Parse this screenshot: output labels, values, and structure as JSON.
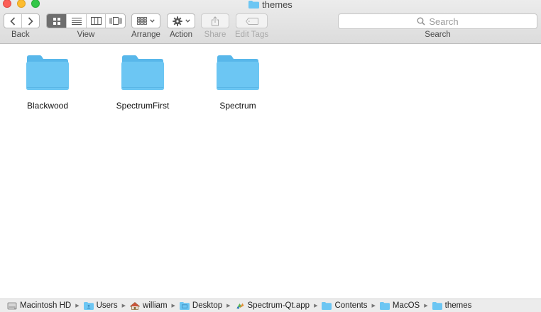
{
  "window": {
    "title": "themes"
  },
  "toolbar": {
    "back_label": "Back",
    "view_label": "View",
    "arrange_label": "Arrange",
    "action_label": "Action",
    "share_label": "Share",
    "edit_tags_label": "Edit Tags",
    "search_label": "Search",
    "search_placeholder": "Search",
    "selected_view": "icon-view"
  },
  "items": [
    {
      "name": "Blackwood",
      "icon": "folder-icon"
    },
    {
      "name": "SpectrumFirst",
      "icon": "folder-icon"
    },
    {
      "name": "Spectrum",
      "icon": "folder-icon"
    }
  ],
  "path": [
    {
      "label": "Macintosh HD",
      "icon": "hard-drive-icon"
    },
    {
      "label": "Users",
      "icon": "folder-icon"
    },
    {
      "label": "william",
      "icon": "home-icon"
    },
    {
      "label": "Desktop",
      "icon": "folder-icon"
    },
    {
      "label": "Spectrum-Qt.app",
      "icon": "app-icon"
    },
    {
      "label": "Contents",
      "icon": "folder-icon"
    },
    {
      "label": "MacOS",
      "icon": "folder-icon"
    },
    {
      "label": "themes",
      "icon": "folder-icon"
    }
  ],
  "colors": {
    "folder": "#6cc6f3",
    "folder_tab": "#58b7ea",
    "selected_view_bg": "#6e6e6e"
  }
}
